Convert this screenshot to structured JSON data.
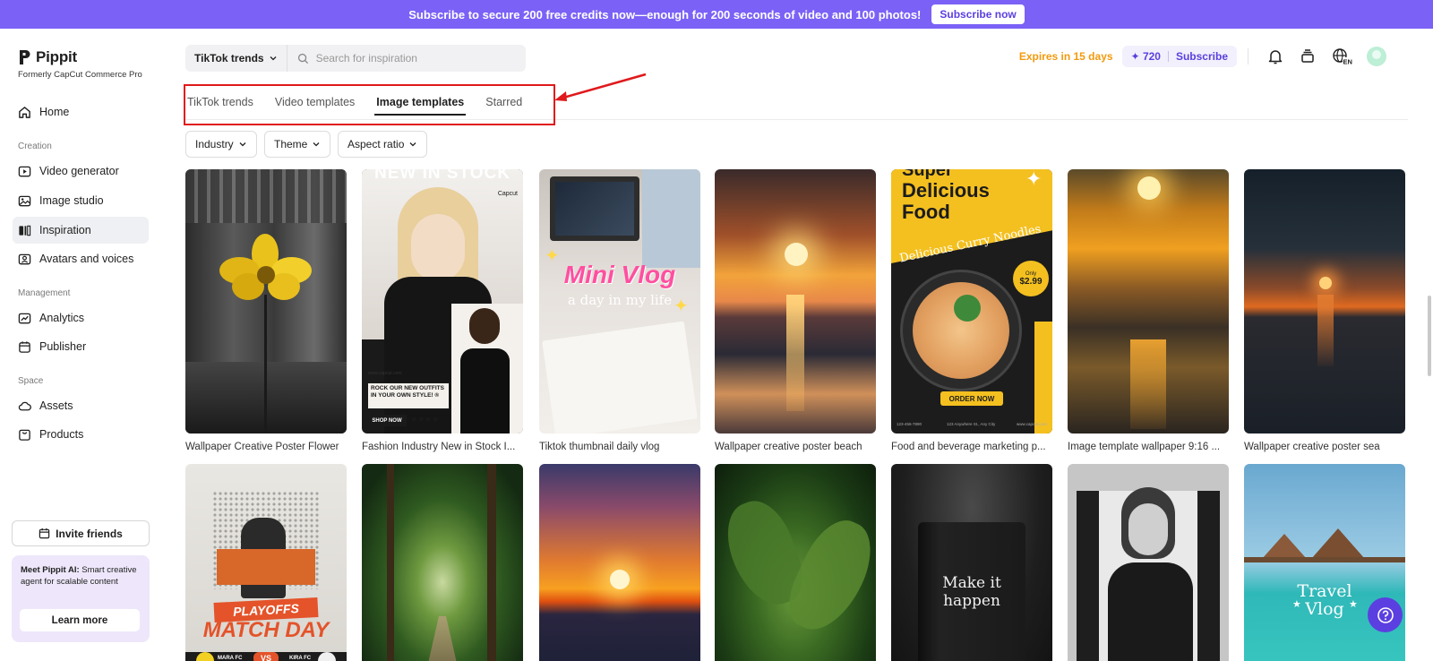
{
  "banner": {
    "text": "Subscribe to secure 200 free credits now—enough for 200 seconds of video and 100 photos!",
    "button": "Subscribe now"
  },
  "brand": {
    "name": "Pippit",
    "subtitle": "Formerly CapCut Commerce Pro"
  },
  "sidebar": {
    "top": [
      {
        "label": "Home",
        "icon": "home-icon"
      }
    ],
    "sections": [
      {
        "title": "Creation",
        "items": [
          {
            "label": "Video generator",
            "icon": "video-generator-icon"
          },
          {
            "label": "Image studio",
            "icon": "image-studio-icon"
          },
          {
            "label": "Inspiration",
            "icon": "inspiration-icon",
            "active": true
          },
          {
            "label": "Avatars and voices",
            "icon": "avatar-icon"
          }
        ]
      },
      {
        "title": "Management",
        "items": [
          {
            "label": "Analytics",
            "icon": "analytics-icon"
          },
          {
            "label": "Publisher",
            "icon": "calendar-icon"
          }
        ]
      },
      {
        "title": "Space",
        "items": [
          {
            "label": "Assets",
            "icon": "cloud-icon"
          },
          {
            "label": "Products",
            "icon": "products-icon"
          }
        ]
      }
    ],
    "invite": "Invite friends",
    "promo": {
      "bold": "Meet Pippit AI:",
      "text": " Smart creative agent for scalable content",
      "button": "Learn more"
    }
  },
  "header": {
    "search_scope": "TikTok trends",
    "search_placeholder": "Search for inspiration",
    "expires": "Expires in 15 days",
    "credits": "720",
    "subscribe": "Subscribe",
    "language": "EN"
  },
  "tabs": [
    {
      "label": "TikTok trends",
      "active": false
    },
    {
      "label": "Video templates",
      "active": false
    },
    {
      "label": "Image templates",
      "active": true
    },
    {
      "label": "Starred",
      "active": false
    }
  ],
  "filters": [
    "Industry",
    "Theme",
    "Aspect ratio"
  ],
  "row1": [
    {
      "caption": "Wallpaper Creative Poster Flower",
      "style": "flower"
    },
    {
      "caption": "Fashion Industry New in Stock I...",
      "style": "fashion",
      "text": "NEW IN STOCK",
      "brand": "Capcut",
      "url": "www.capcut.com",
      "tag": "ROCK OUR NEW OUTFITS IN YOUR OWN STYLE! ®",
      "cta": "SHOP NOW",
      "stars": "★★★★"
    },
    {
      "caption": "Tiktok thumbnail daily vlog",
      "style": "vlog",
      "text": "Mini Vlog",
      "sub": "a day in my life"
    },
    {
      "caption": "Wallpaper creative poster beach",
      "style": "beach"
    },
    {
      "caption": "Food and beverage marketing p...",
      "style": "food",
      "text1": "Super",
      "text2": "Delicious",
      "text3": "Food",
      "sub": "Delicious Curry Noodles",
      "price_label": "Only",
      "price": "$2.99",
      "cta": "ORDER NOW",
      "phone": "123-456-7890",
      "address": "123 Anywhere St., Any City",
      "url": "www.capcut.com"
    },
    {
      "caption": "Image template wallpaper 9:16 ...",
      "style": "sunset2"
    },
    {
      "caption": "Wallpaper creative poster sea",
      "style": "sea"
    }
  ],
  "row2": [
    {
      "style": "playoffs",
      "text1": "PLAYOFFS",
      "text2": "MATCH DAY",
      "team1": "MARA FC",
      "team2": "KIRA FC"
    },
    {
      "style": "forest"
    },
    {
      "style": "sunset3"
    },
    {
      "style": "jungle"
    },
    {
      "style": "book",
      "text": "Make it happen"
    },
    {
      "style": "portrait"
    },
    {
      "style": "travel",
      "text": "Travel Vlog"
    }
  ]
}
